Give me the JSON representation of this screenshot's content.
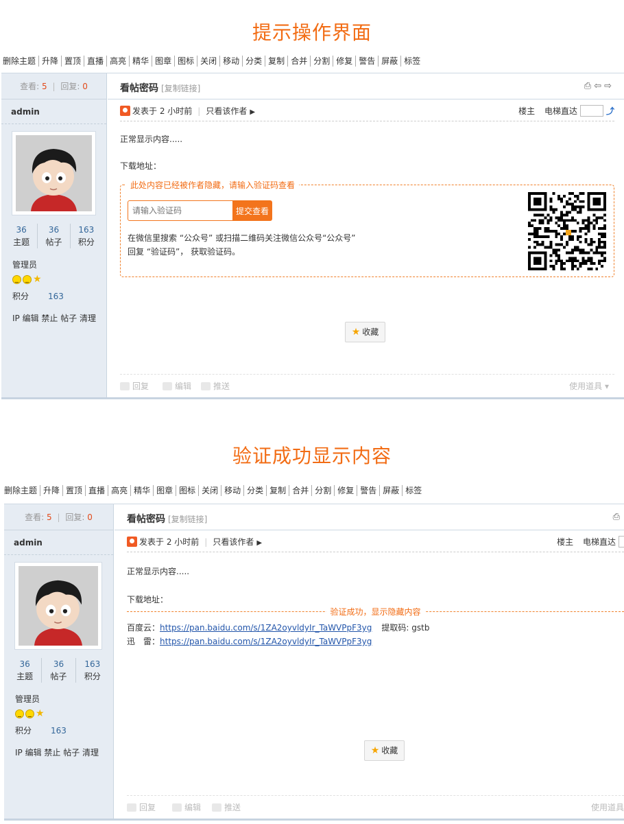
{
  "top": {
    "section_title": "提示操作界面",
    "toolbar": [
      "删除主题",
      "升降",
      "置顶",
      "直播",
      "高亮",
      "精华",
      "图章",
      "图标",
      "关闭",
      "移动",
      "分类",
      "复制",
      "合并",
      "分割",
      "修复",
      "警告",
      "屏蔽",
      "标签"
    ],
    "stats": {
      "views_label": "查看:",
      "views": "5",
      "replies_label": "回复:",
      "replies": "0"
    },
    "thread_title": "看帖密码",
    "copy_link": "[复制链接]",
    "posted": "发表于 2 小时前",
    "only_author": "只看该作者",
    "louzhu": "楼主",
    "lift": "电梯直达",
    "user": {
      "name": "admin",
      "topics": "36",
      "topics_label": "主题",
      "posts": "36",
      "posts_label": "帖子",
      "credits": "163",
      "credits_label": "积分",
      "group": "管理员",
      "jifen_label": "积分",
      "jifen": "163",
      "admin_links": "IP 编辑 禁止 帖子 清理"
    },
    "body_line1": "正常显示内容.....",
    "body_line2": "下载地址：",
    "hidden": {
      "legend": "此处内容已经被作者隐藏，请输入验证码查看",
      "input_placeholder": "请输入验证码",
      "submit": "提交查看",
      "tip1": "在微信里搜索 “公众号” 或扫描二维码关注微信公众号“公众号”",
      "tip2": "回复 “验证码”， 获取验证码。"
    },
    "favorite": "收藏",
    "actions": {
      "reply": "回复",
      "edit": "编辑",
      "push": "推送",
      "tools": "使用道具"
    }
  },
  "bottom": {
    "section_title": "验证成功显示内容",
    "toolbar": [
      "删除主题",
      "升降",
      "置顶",
      "直播",
      "高亮",
      "精华",
      "图章",
      "图标",
      "关闭",
      "移动",
      "分类",
      "复制",
      "合并",
      "分割",
      "修复",
      "警告",
      "屏蔽",
      "标签"
    ],
    "stats": {
      "views_label": "查看:",
      "views": "5",
      "replies_label": "回复:",
      "replies": "0"
    },
    "thread_title": "看帖密码",
    "copy_link": "[复制链接]",
    "posted": "发表于 2 小时前",
    "only_author": "只看该作者",
    "louzhu": "楼主",
    "lift": "电梯直达",
    "user": {
      "name": "admin",
      "topics": "36",
      "topics_label": "主题",
      "posts": "36",
      "posts_label": "帖子",
      "credits": "163",
      "credits_label": "积分",
      "group": "管理员",
      "jifen_label": "积分",
      "jifen": "163",
      "admin_links": "IP 编辑 禁止 帖子 清理"
    },
    "body_line1": "正常显示内容.....",
    "body_line2": "下载地址：",
    "success_legend": "验证成功，显示隐藏内容",
    "baidu_label": "百度云：",
    "baidu_link": "https://pan.baidu.com/s/1ZA2oyvldyIr_TaWVPpF3yg",
    "extract_label": "提取码: gstb",
    "xunlei_label": "迅　雷：",
    "xunlei_link": "https://pan.baidu.com/s/1ZA2oyvldyIr_TaWVPpF3yg",
    "favorite": "收藏",
    "actions": {
      "reply": "回复",
      "edit": "编辑",
      "push": "推送",
      "tools": "使用道具"
    }
  },
  "colors": {
    "accent": "#f26c14",
    "link": "#2255aa",
    "side_bg": "#e6ecf3"
  },
  "icons": [
    "print-icon",
    "prev-thread-icon",
    "next-thread-icon",
    "author-icon",
    "play-arrow-icon",
    "lift-go-icon",
    "face-icon",
    "star-icon",
    "reply-icon",
    "edit-icon",
    "push-icon",
    "qr-code-image"
  ]
}
